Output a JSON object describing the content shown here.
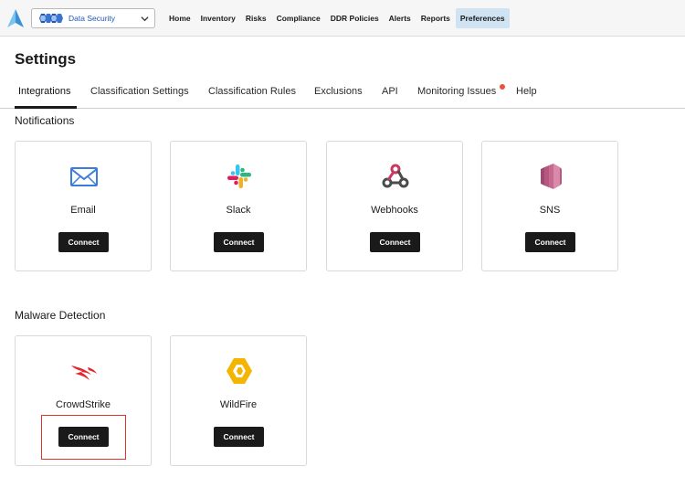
{
  "app": {
    "module_selector": {
      "label": "Data Security",
      "icon": "module-hexagons-icon"
    },
    "nav": [
      {
        "label": "Home"
      },
      {
        "label": "Inventory"
      },
      {
        "label": "Risks"
      },
      {
        "label": "Compliance"
      },
      {
        "label": "DDR Policies"
      },
      {
        "label": "Alerts"
      },
      {
        "label": "Reports"
      },
      {
        "label": "Preferences",
        "active": true
      }
    ]
  },
  "page": {
    "title": "Settings"
  },
  "tabs": [
    {
      "label": "Integrations",
      "active": true
    },
    {
      "label": "Classification Settings"
    },
    {
      "label": "Classification Rules"
    },
    {
      "label": "Exclusions"
    },
    {
      "label": "API"
    },
    {
      "label": "Monitoring Issues",
      "has_notification": true
    },
    {
      "label": "Help"
    }
  ],
  "sections": [
    {
      "title": "Notifications",
      "integrations": [
        {
          "name": "Email",
          "icon": "envelope-icon",
          "button": "Connect"
        },
        {
          "name": "Slack",
          "icon": "slack-icon",
          "button": "Connect"
        },
        {
          "name": "Webhooks",
          "icon": "webhooks-icon",
          "button": "Connect"
        },
        {
          "name": "SNS",
          "icon": "sns-icon",
          "button": "Connect"
        }
      ]
    },
    {
      "title": "Malware Detection",
      "integrations": [
        {
          "name": "CrowdStrike",
          "icon": "crowdstrike-icon",
          "button": "Connect",
          "highlighted": true
        },
        {
          "name": "WildFire",
          "icon": "wildfire-icon",
          "button": "Connect"
        }
      ]
    }
  ],
  "colors": {
    "accent": "#1f57b8",
    "active_nav_bg": "#cfe3f3",
    "button_bg": "#1a1a1a",
    "notification_dot": "#e8533f",
    "highlight_border": "#e0342a"
  }
}
